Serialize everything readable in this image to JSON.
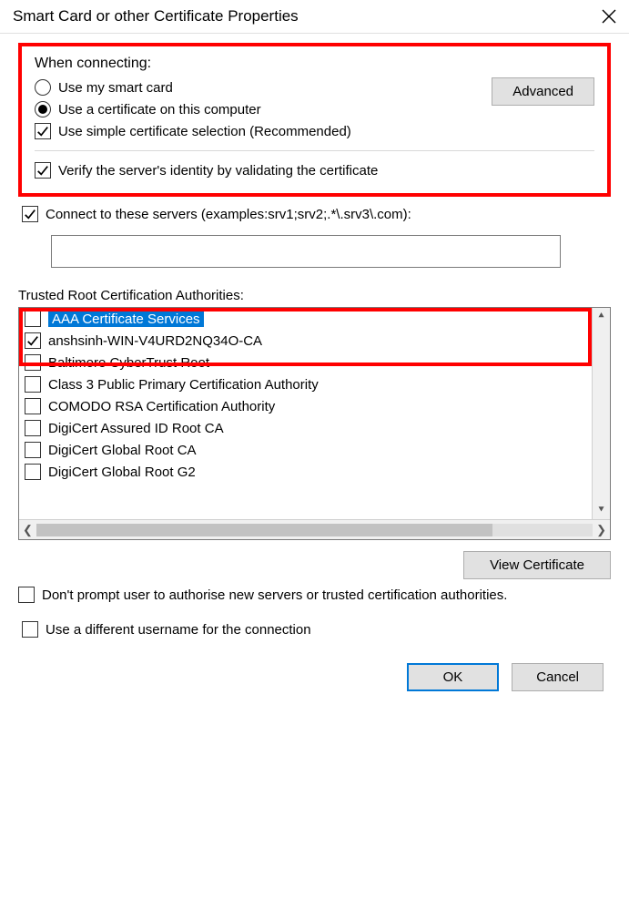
{
  "title": "Smart Card or other Certificate Properties",
  "when_connecting_label": "When connecting:",
  "radio_smart_card": "Use my smart card",
  "radio_cert_computer": "Use a certificate on this computer",
  "advanced_btn": "Advanced",
  "check_simple_selection": "Use simple certificate selection (Recommended)",
  "check_verify_identity": "Verify the server's identity by validating the certificate",
  "check_connect_servers": "Connect to these servers (examples:srv1;srv2;.*\\.srv3\\.com):",
  "servers_input_value": "",
  "ca_list_label": "Trusted Root Certification Authorities:",
  "ca_items": [
    {
      "label": "AAA Certificate Services",
      "checked": false,
      "selected": true
    },
    {
      "label": "anshsinh-WIN-V4URD2NQ34O-CA",
      "checked": true,
      "selected": false
    },
    {
      "label": "Baltimore CyberTrust Root",
      "checked": false,
      "selected": false
    },
    {
      "label": "Class 3 Public Primary Certification Authority",
      "checked": false,
      "selected": false
    },
    {
      "label": "COMODO RSA Certification Authority",
      "checked": false,
      "selected": false
    },
    {
      "label": "DigiCert Assured ID Root CA",
      "checked": false,
      "selected": false
    },
    {
      "label": "DigiCert Global Root CA",
      "checked": false,
      "selected": false
    },
    {
      "label": "DigiCert Global Root G2",
      "checked": false,
      "selected": false
    }
  ],
  "view_certificate_btn": "View Certificate",
  "check_dont_prompt": "Don't prompt user to authorise new servers or trusted certification authorities.",
  "check_diff_username": "Use a different username for the connection",
  "ok_btn": "OK",
  "cancel_btn": "Cancel"
}
